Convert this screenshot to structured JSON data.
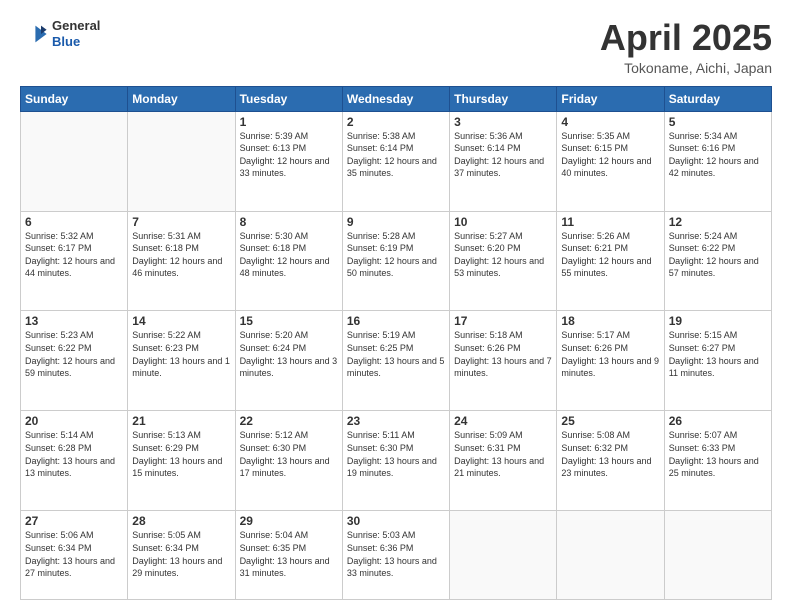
{
  "header": {
    "logo_general": "General",
    "logo_blue": "Blue",
    "month_title": "April 2025",
    "location": "Tokoname, Aichi, Japan"
  },
  "weekdays": [
    "Sunday",
    "Monday",
    "Tuesday",
    "Wednesday",
    "Thursday",
    "Friday",
    "Saturday"
  ],
  "weeks": [
    [
      {
        "day": "",
        "sunrise": "",
        "sunset": "",
        "daylight": ""
      },
      {
        "day": "",
        "sunrise": "",
        "sunset": "",
        "daylight": ""
      },
      {
        "day": "1",
        "sunrise": "Sunrise: 5:39 AM",
        "sunset": "Sunset: 6:13 PM",
        "daylight": "Daylight: 12 hours and 33 minutes."
      },
      {
        "day": "2",
        "sunrise": "Sunrise: 5:38 AM",
        "sunset": "Sunset: 6:14 PM",
        "daylight": "Daylight: 12 hours and 35 minutes."
      },
      {
        "day": "3",
        "sunrise": "Sunrise: 5:36 AM",
        "sunset": "Sunset: 6:14 PM",
        "daylight": "Daylight: 12 hours and 37 minutes."
      },
      {
        "day": "4",
        "sunrise": "Sunrise: 5:35 AM",
        "sunset": "Sunset: 6:15 PM",
        "daylight": "Daylight: 12 hours and 40 minutes."
      },
      {
        "day": "5",
        "sunrise": "Sunrise: 5:34 AM",
        "sunset": "Sunset: 6:16 PM",
        "daylight": "Daylight: 12 hours and 42 minutes."
      }
    ],
    [
      {
        "day": "6",
        "sunrise": "Sunrise: 5:32 AM",
        "sunset": "Sunset: 6:17 PM",
        "daylight": "Daylight: 12 hours and 44 minutes."
      },
      {
        "day": "7",
        "sunrise": "Sunrise: 5:31 AM",
        "sunset": "Sunset: 6:18 PM",
        "daylight": "Daylight: 12 hours and 46 minutes."
      },
      {
        "day": "8",
        "sunrise": "Sunrise: 5:30 AM",
        "sunset": "Sunset: 6:18 PM",
        "daylight": "Daylight: 12 hours and 48 minutes."
      },
      {
        "day": "9",
        "sunrise": "Sunrise: 5:28 AM",
        "sunset": "Sunset: 6:19 PM",
        "daylight": "Daylight: 12 hours and 50 minutes."
      },
      {
        "day": "10",
        "sunrise": "Sunrise: 5:27 AM",
        "sunset": "Sunset: 6:20 PM",
        "daylight": "Daylight: 12 hours and 53 minutes."
      },
      {
        "day": "11",
        "sunrise": "Sunrise: 5:26 AM",
        "sunset": "Sunset: 6:21 PM",
        "daylight": "Daylight: 12 hours and 55 minutes."
      },
      {
        "day": "12",
        "sunrise": "Sunrise: 5:24 AM",
        "sunset": "Sunset: 6:22 PM",
        "daylight": "Daylight: 12 hours and 57 minutes."
      }
    ],
    [
      {
        "day": "13",
        "sunrise": "Sunrise: 5:23 AM",
        "sunset": "Sunset: 6:22 PM",
        "daylight": "Daylight: 12 hours and 59 minutes."
      },
      {
        "day": "14",
        "sunrise": "Sunrise: 5:22 AM",
        "sunset": "Sunset: 6:23 PM",
        "daylight": "Daylight: 13 hours and 1 minute."
      },
      {
        "day": "15",
        "sunrise": "Sunrise: 5:20 AM",
        "sunset": "Sunset: 6:24 PM",
        "daylight": "Daylight: 13 hours and 3 minutes."
      },
      {
        "day": "16",
        "sunrise": "Sunrise: 5:19 AM",
        "sunset": "Sunset: 6:25 PM",
        "daylight": "Daylight: 13 hours and 5 minutes."
      },
      {
        "day": "17",
        "sunrise": "Sunrise: 5:18 AM",
        "sunset": "Sunset: 6:26 PM",
        "daylight": "Daylight: 13 hours and 7 minutes."
      },
      {
        "day": "18",
        "sunrise": "Sunrise: 5:17 AM",
        "sunset": "Sunset: 6:26 PM",
        "daylight": "Daylight: 13 hours and 9 minutes."
      },
      {
        "day": "19",
        "sunrise": "Sunrise: 5:15 AM",
        "sunset": "Sunset: 6:27 PM",
        "daylight": "Daylight: 13 hours and 11 minutes."
      }
    ],
    [
      {
        "day": "20",
        "sunrise": "Sunrise: 5:14 AM",
        "sunset": "Sunset: 6:28 PM",
        "daylight": "Daylight: 13 hours and 13 minutes."
      },
      {
        "day": "21",
        "sunrise": "Sunrise: 5:13 AM",
        "sunset": "Sunset: 6:29 PM",
        "daylight": "Daylight: 13 hours and 15 minutes."
      },
      {
        "day": "22",
        "sunrise": "Sunrise: 5:12 AM",
        "sunset": "Sunset: 6:30 PM",
        "daylight": "Daylight: 13 hours and 17 minutes."
      },
      {
        "day": "23",
        "sunrise": "Sunrise: 5:11 AM",
        "sunset": "Sunset: 6:30 PM",
        "daylight": "Daylight: 13 hours and 19 minutes."
      },
      {
        "day": "24",
        "sunrise": "Sunrise: 5:09 AM",
        "sunset": "Sunset: 6:31 PM",
        "daylight": "Daylight: 13 hours and 21 minutes."
      },
      {
        "day": "25",
        "sunrise": "Sunrise: 5:08 AM",
        "sunset": "Sunset: 6:32 PM",
        "daylight": "Daylight: 13 hours and 23 minutes."
      },
      {
        "day": "26",
        "sunrise": "Sunrise: 5:07 AM",
        "sunset": "Sunset: 6:33 PM",
        "daylight": "Daylight: 13 hours and 25 minutes."
      }
    ],
    [
      {
        "day": "27",
        "sunrise": "Sunrise: 5:06 AM",
        "sunset": "Sunset: 6:34 PM",
        "daylight": "Daylight: 13 hours and 27 minutes."
      },
      {
        "day": "28",
        "sunrise": "Sunrise: 5:05 AM",
        "sunset": "Sunset: 6:34 PM",
        "daylight": "Daylight: 13 hours and 29 minutes."
      },
      {
        "day": "29",
        "sunrise": "Sunrise: 5:04 AM",
        "sunset": "Sunset: 6:35 PM",
        "daylight": "Daylight: 13 hours and 31 minutes."
      },
      {
        "day": "30",
        "sunrise": "Sunrise: 5:03 AM",
        "sunset": "Sunset: 6:36 PM",
        "daylight": "Daylight: 13 hours and 33 minutes."
      },
      {
        "day": "",
        "sunrise": "",
        "sunset": "",
        "daylight": ""
      },
      {
        "day": "",
        "sunrise": "",
        "sunset": "",
        "daylight": ""
      },
      {
        "day": "",
        "sunrise": "",
        "sunset": "",
        "daylight": ""
      }
    ]
  ]
}
